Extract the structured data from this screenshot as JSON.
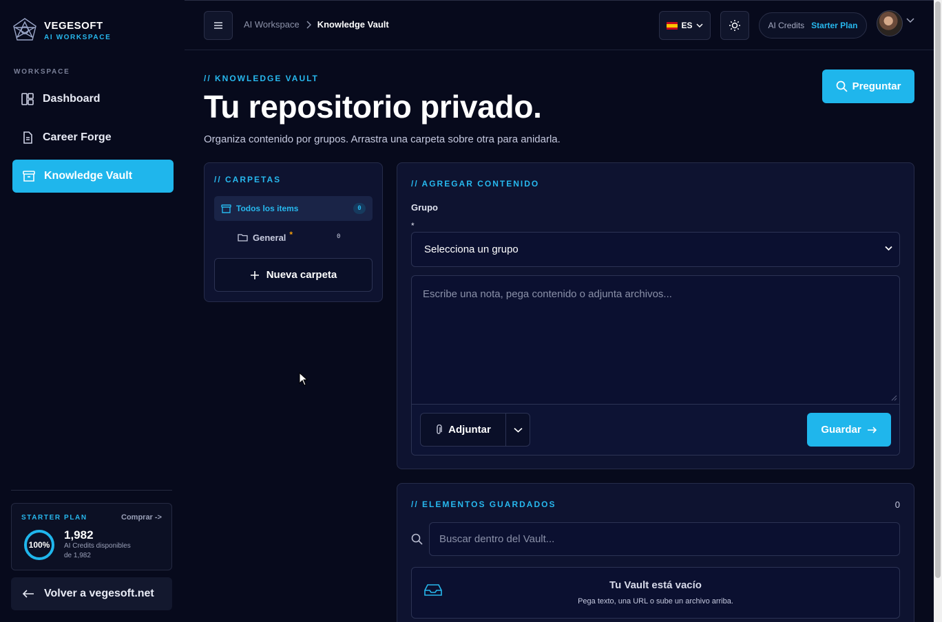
{
  "brand": {
    "name": "VEGESOFT",
    "subtitle": "AI WORKSPACE",
    "logo_icon": "network-star-logo"
  },
  "sidebar": {
    "section_label": "WORKSPACE",
    "items": [
      {
        "label": "Dashboard",
        "icon": "dashboard-grid-icon",
        "active": false
      },
      {
        "label": "Career Forge",
        "icon": "document-icon",
        "active": false
      },
      {
        "label": "Knowledge Vault",
        "icon": "archive-box-icon",
        "active": true
      }
    ],
    "plan": {
      "title": "STARTER PLAN",
      "buy_label": "Comprar ->",
      "percent_label": "100%",
      "percent_value": 1.0,
      "credits": "1,982",
      "credits_caption": "AI Credits disponibles",
      "credits_total": "de 1,982"
    },
    "back_label": "Volver a vegesoft.net"
  },
  "header": {
    "breadcrumb": [
      "AI Workspace",
      "Knowledge Vault"
    ],
    "language": "ES",
    "credits_label": "AI Credits",
    "plan_label": "Starter Plan"
  },
  "main": {
    "eyebrow": "// KNOWLEDGE VAULT",
    "title": "Tu repositorio privado.",
    "subtitle": "Organiza contenido por grupos. Arrastra una carpeta sobre otra para anidarla.",
    "ask_label": "Preguntar"
  },
  "folders": {
    "title": "// CARPETAS",
    "all_items_label": "Todos los items",
    "all_items_count": "0",
    "general_label": "General",
    "general_star": "*",
    "general_count": "0",
    "new_folder_label": "Nueva carpeta"
  },
  "add_content": {
    "title": "// AGREGAR CONTENIDO",
    "group_label": "Grupo",
    "required_mark": "*",
    "group_select_value": "Selecciona un grupo",
    "note_placeholder": "Escribe una nota, pega contenido o adjunta archivos...",
    "attach_label": "Adjuntar",
    "save_label": "Guardar"
  },
  "saved": {
    "title": "// ELEMENTOS GUARDADOS",
    "count": "0",
    "search_placeholder": "Buscar dentro del Vault...",
    "empty_title": "Tu Vault está vacío",
    "empty_subtitle": "Pega texto, una URL o sube un archivo arriba."
  },
  "colors": {
    "accent": "#1fb6ec",
    "background": "#070a1c",
    "panel": "#0e1330",
    "star": "#f59e0b"
  }
}
